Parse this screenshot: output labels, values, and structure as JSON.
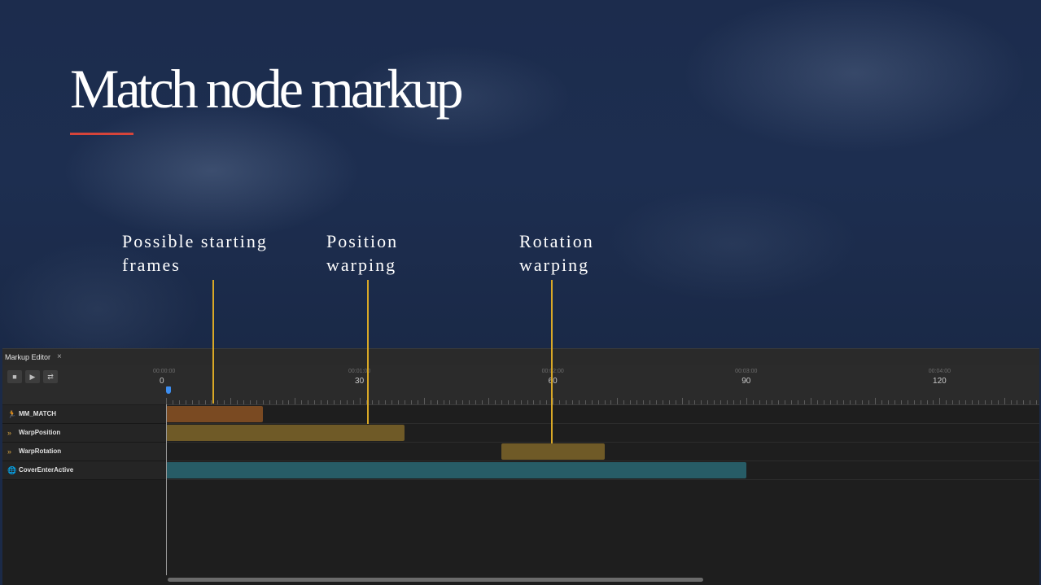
{
  "slide": {
    "title": "Match node markup",
    "annotations": [
      {
        "id": "starting-frames",
        "lines": [
          "Possible starting",
          "frames"
        ]
      },
      {
        "id": "position-warping",
        "lines": [
          "Position",
          "warping"
        ]
      },
      {
        "id": "rotation-warping",
        "lines": [
          "Rotation",
          "warping"
        ]
      }
    ]
  },
  "colors": {
    "accent_rule": "#d6443a",
    "pointer": "#d9a826",
    "playhead": "#3d8ef0",
    "clip_match": "#7a4a22",
    "clip_warp": "#6f5a27",
    "clip_cover": "#275c66"
  },
  "editor": {
    "tab_label": "Markup Editor",
    "close_glyph": "×",
    "buttons": [
      {
        "name": "stop-button",
        "icon": "stop-icon",
        "glyph": "■"
      },
      {
        "name": "play-button",
        "icon": "play-icon",
        "glyph": "▶"
      },
      {
        "name": "loop-button",
        "icon": "loop-icon",
        "glyph": "⇄"
      }
    ],
    "timeline": {
      "frame_range": [
        0,
        136
      ],
      "ticks": [
        {
          "time": "00:00:00",
          "frame": "0"
        },
        {
          "time": "00:01:00",
          "frame": "30"
        },
        {
          "time": "00:02:00",
          "frame": "60"
        },
        {
          "time": "00:03:00",
          "frame": "90"
        },
        {
          "time": "00:04:00",
          "frame": "120"
        }
      ],
      "tick_frames": [
        0,
        30,
        60,
        90,
        120
      ]
    },
    "tracks": [
      {
        "name": "MM_MATCH",
        "icon": "running-person-icon",
        "glyph": "🏃",
        "color": "#c07a3e"
      },
      {
        "name": "WarpPosition",
        "icon": "double-chevron-icon",
        "glyph": "»",
        "color": "#d6a544"
      },
      {
        "name": "WarpRotation",
        "icon": "double-chevron-icon",
        "glyph": "»",
        "color": "#d6a544"
      },
      {
        "name": "CoverEnterActive",
        "icon": "globe-icon",
        "glyph": "🌐",
        "color": "#3f9fb0"
      }
    ],
    "clips": [
      {
        "track": 0,
        "start": 0,
        "end": 15
      },
      {
        "track": 1,
        "start": 0,
        "end": 37
      },
      {
        "track": 2,
        "start": 52,
        "end": 68
      },
      {
        "track": 3,
        "start": 0,
        "end": 90
      }
    ]
  }
}
